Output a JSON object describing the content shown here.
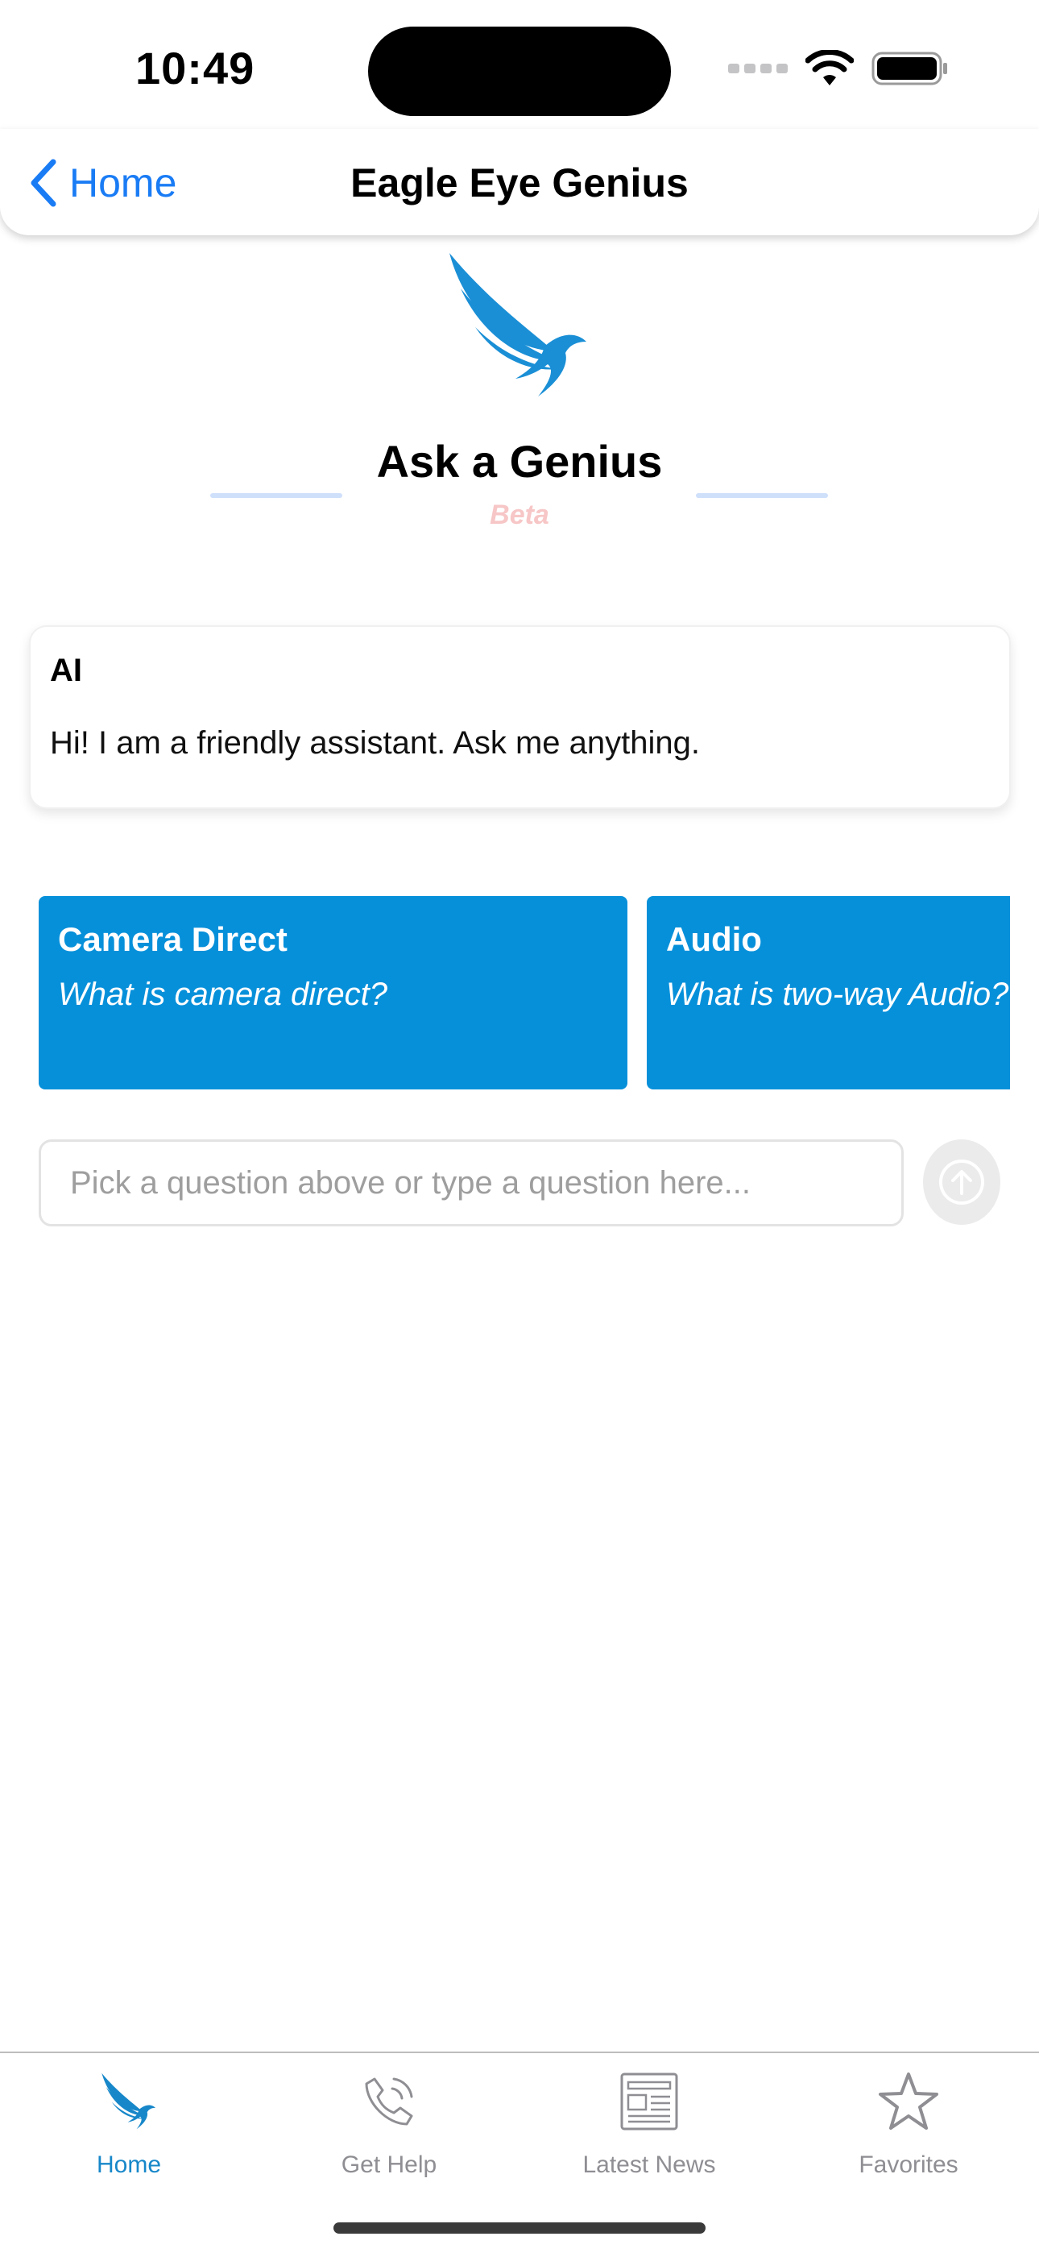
{
  "status_bar": {
    "time": "10:49"
  },
  "nav": {
    "back_label": "Home",
    "title": "Eagle Eye Genius"
  },
  "hero": {
    "title": "Ask a Genius",
    "badge": "Beta"
  },
  "chat": {
    "messages": [
      {
        "sender": "AI",
        "text": "Hi! I am a friendly assistant. Ask me anything."
      }
    ]
  },
  "suggestions": [
    {
      "title": "Camera Direct",
      "question": "What is camera direct?"
    },
    {
      "title": "Audio",
      "question": "What is two-way Audio?"
    }
  ],
  "input": {
    "placeholder": "Pick a question above or type a question here..."
  },
  "tabs": [
    {
      "label": "Home",
      "icon": "eagle-logo-icon",
      "active": true
    },
    {
      "label": "Get Help",
      "icon": "phone-icon",
      "active": false
    },
    {
      "label": "Latest News",
      "icon": "newspaper-icon",
      "active": false
    },
    {
      "label": "Favorites",
      "icon": "star-icon",
      "active": false
    }
  ],
  "colors": {
    "accent": "#1a7cf5",
    "brand": "#0790da",
    "active_tab": "#1787c9",
    "beta": "#f7c6c6"
  }
}
